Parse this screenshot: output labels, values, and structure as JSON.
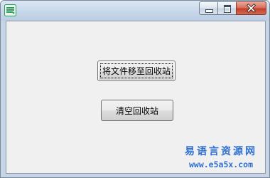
{
  "window": {
    "title": "",
    "app_icon": "green-striped-app-icon",
    "controls": {
      "minimize_icon": "minimize-icon",
      "maximize_icon": "maximize-icon",
      "close_icon": "close-icon"
    },
    "colors": {
      "titlebar": "#c7d7ea",
      "client_background": "#f0f0f0",
      "close_button": "#c3402a",
      "app_icon": "#2e9a5a"
    }
  },
  "buttons": {
    "move_to_recycle_bin": "将文件移至回收站",
    "empty_recycle_bin": "清空回收站"
  },
  "watermark": {
    "name": "易语言资源网",
    "url": "www.e5a5x.com",
    "color": "#2f6fd0"
  }
}
